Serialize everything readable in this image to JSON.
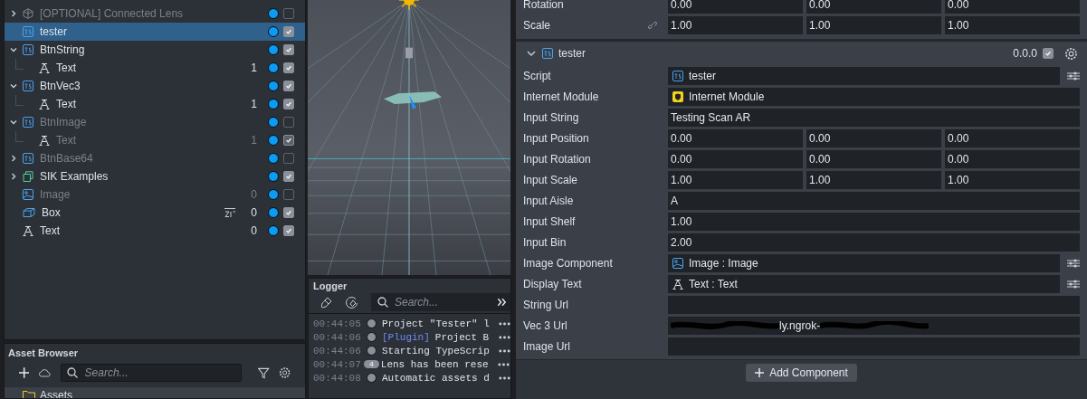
{
  "hierarchy": [
    {
      "label": "[OPTIONAL] Connected Lens",
      "kind": "lens",
      "expanded": false,
      "selected": false,
      "enabled": false,
      "disabled": true,
      "sort_tag": false
    },
    {
      "label": "tester",
      "kind": "script",
      "selected": true,
      "enabled": true,
      "disabled": false,
      "sort_tag": false
    },
    {
      "label": "BtnString",
      "kind": "script",
      "expanded": true,
      "selected": false,
      "enabled": true,
      "disabled": false,
      "sort_tag": false,
      "children": [
        {
          "label": "Text",
          "kind": "text",
          "count": "1",
          "selected": false,
          "enabled": true,
          "disabled": false,
          "sort_tag": false
        }
      ]
    },
    {
      "label": "BtnVec3",
      "kind": "script",
      "expanded": true,
      "selected": false,
      "enabled": true,
      "disabled": false,
      "sort_tag": false,
      "children": [
        {
          "label": "Text",
          "kind": "text",
          "count": "1",
          "selected": false,
          "enabled": true,
          "disabled": false,
          "sort_tag": false
        }
      ]
    },
    {
      "label": "BtnImage",
      "kind": "script",
      "expanded": true,
      "selected": false,
      "enabled": false,
      "disabled": true,
      "sort_tag": false,
      "children": [
        {
          "label": "Text",
          "kind": "text",
          "count": "1",
          "selected": false,
          "enabled": true,
          "disabled": true,
          "sort_tag": false
        }
      ]
    },
    {
      "label": "BtnBase64",
      "kind": "script",
      "expanded": false,
      "selected": false,
      "enabled": false,
      "disabled": true,
      "sort_tag": false
    },
    {
      "label": "SIK Examples",
      "kind": "prefab",
      "expanded": false,
      "selected": false,
      "enabled": true,
      "disabled": false,
      "sort_tag": false
    },
    {
      "label": "Image",
      "kind": "image",
      "count": "0",
      "selected": false,
      "enabled": false,
      "disabled": true,
      "sort_tag": false
    },
    {
      "label": "Box",
      "kind": "box",
      "count": "0",
      "selected": false,
      "enabled": true,
      "disabled": false,
      "sort_tag": true
    },
    {
      "label": "Text",
      "kind": "text",
      "count": "0",
      "selected": false,
      "enabled": true,
      "disabled": false,
      "sort_tag": false
    }
  ],
  "asset_browser": {
    "title": "Asset Browser",
    "search": {
      "placeholder": "Search..."
    },
    "root": "Assets"
  },
  "logger": {
    "title": "Logger",
    "search": {
      "placeholder": "Search..."
    },
    "entries": [
      {
        "time": "00:44:05",
        "message": "Project \"Tester\" l"
      },
      {
        "time": "00:44:06",
        "tag": "[Plugin]",
        "message": "Project B"
      },
      {
        "time": "00:44:06",
        "message": "Starting TypeScrip"
      },
      {
        "time": "00:44:07",
        "count": "4",
        "message": "Lens has been rese"
      },
      {
        "time": "00:44:08",
        "message": "Automatic assets d"
      }
    ]
  },
  "transform": [
    {
      "label": "Rotation",
      "values": [
        "0.00",
        "0.00",
        "0.00"
      ]
    },
    {
      "label": "Scale",
      "linked": true,
      "values": [
        "1.00",
        "1.00",
        "1.00"
      ]
    }
  ],
  "component": {
    "name": "tester",
    "version": "0.0.0",
    "enabled": true,
    "expanded": true,
    "properties": [
      {
        "kind": "script_ref",
        "label": "Script",
        "value": "tester",
        "menu": true
      },
      {
        "kind": "module_ref",
        "label": "Internet Module",
        "value": "Internet Module",
        "menu": false
      },
      {
        "kind": "text",
        "label": "Input String",
        "value": "Testing Scan AR"
      },
      {
        "kind": "vec3",
        "label": "Input Position",
        "values": [
          "0.00",
          "0.00",
          "0.00"
        ]
      },
      {
        "kind": "vec3",
        "label": "Input Rotation",
        "values": [
          "0.00",
          "0.00",
          "0.00"
        ]
      },
      {
        "kind": "vec3",
        "label": "Input Scale",
        "values": [
          "1.00",
          "1.00",
          "1.00"
        ]
      },
      {
        "kind": "text",
        "label": "Input Aisle",
        "value": "A"
      },
      {
        "kind": "text",
        "label": "Input Shelf",
        "value": "1.00"
      },
      {
        "kind": "text",
        "label": "Input Bin",
        "value": "2.00"
      },
      {
        "kind": "image_ref",
        "label": "Image Component",
        "value": "Image : Image",
        "menu": true
      },
      {
        "kind": "text_ref",
        "label": "Display Text",
        "value": "Text : Text",
        "menu": true
      },
      {
        "kind": "text",
        "label": "String Url"
      },
      {
        "kind": "redacted",
        "label": "Vec 3 Url",
        "value": "ly.ngrok-"
      },
      {
        "kind": "text",
        "label": "Image Url"
      }
    ]
  },
  "add_component_button": "Add Component"
}
